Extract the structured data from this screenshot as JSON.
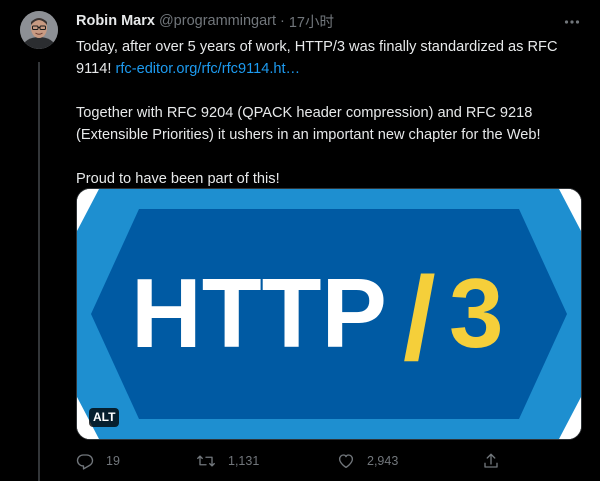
{
  "author": {
    "display_name": "Robin Marx",
    "handle": "@programmingart",
    "separator": "·",
    "time": "17小时"
  },
  "tweet": {
    "line1": "Today, after over 5 years of work, HTTP/3 was finally standardized as RFC",
    "line2_prefix": "9114! ",
    "link_text": "rfc-editor.org/rfc/rfc9114.ht…",
    "paragraph2": "Together with RFC 9204 (QPACK header compression) and RFC 9218 (Extensible Priorities) it ushers in an important new chapter for the Web!",
    "paragraph3": "Proud to have been part of this!"
  },
  "media": {
    "logo_main": "HTTP",
    "logo_slash": "/",
    "logo_version": "3",
    "alt_badge": "ALT",
    "colors": {
      "outer": "#1e8fd0",
      "inner": "#005aa3",
      "text": "#ffffff",
      "accent": "#f5cf3a"
    }
  },
  "actions": {
    "reply": {
      "icon": "reply-icon",
      "count": "19"
    },
    "retweet": {
      "icon": "retweet-icon",
      "count": "1,131"
    },
    "like": {
      "icon": "heart-icon",
      "count": "2,943"
    },
    "share": {
      "icon": "share-icon"
    }
  }
}
